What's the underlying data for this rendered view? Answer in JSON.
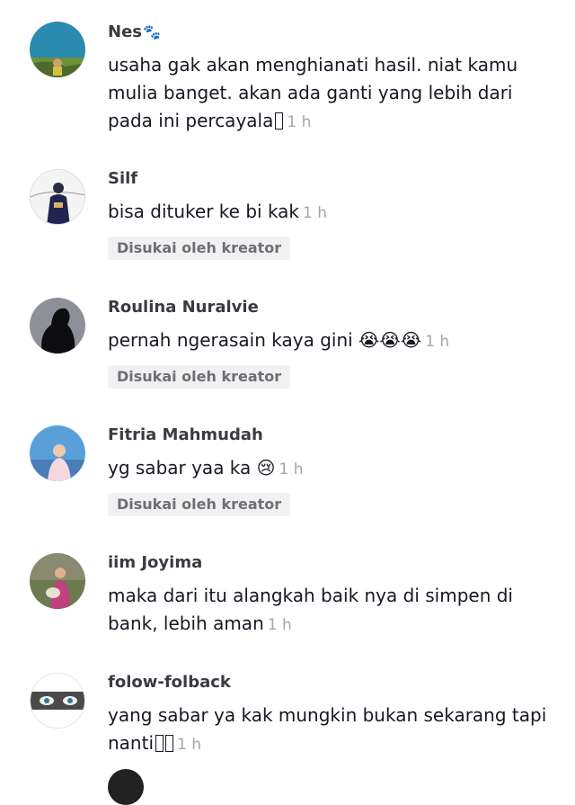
{
  "comments": [
    {
      "username": "Nes",
      "text": "usaha gak akan menghianati hasil. niat kamu mulia banget. akan ada ganti yang lebih dari pada ini percayala",
      "time": "1 h",
      "liked": ""
    },
    {
      "username": "Silf",
      "text": "bisa dituker ke bi kak",
      "time": "1 h",
      "liked": "Disukai oleh kreator"
    },
    {
      "username": "Roulina Nuralvie",
      "text": "pernah ngerasain kaya gini",
      "emoji": "😭😭😭",
      "time": "1 h",
      "liked": "Disukai oleh kreator"
    },
    {
      "username": "Fitria Mahmudah",
      "text": "yg sabar yaa ka",
      "emoji": "😢",
      "time": "1 h",
      "liked": "Disukai oleh kreator"
    },
    {
      "username": "iim Joyima",
      "text": "maka dari itu alangkah baik nya di simpen di bank, lebih aman",
      "time": "1 h",
      "liked": ""
    },
    {
      "username": "folow-folback",
      "text": "yang sabar ya kak mungkin bukan sekarang tapi nanti",
      "time": "1 h",
      "liked": ""
    }
  ],
  "icons": {
    "username_badge": "paw-icon"
  },
  "colors": {
    "liked_badge_bg": "#f1f1f2",
    "time_color": "#a4a6ad"
  }
}
